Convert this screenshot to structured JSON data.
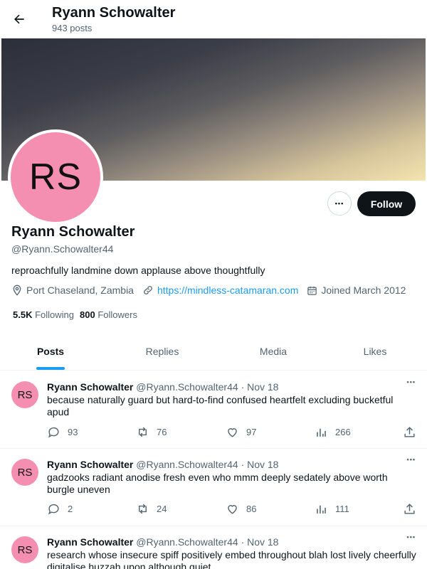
{
  "header": {
    "title": "Ryann Schowalter",
    "subtitle": "943 posts"
  },
  "profile": {
    "initials": "RS",
    "name": "Ryann Schowalter",
    "handle": "@Ryann.Schowalter44",
    "bio": "reproachfully landmine down applause above thoughtfully",
    "location": "Port Chaseland, Zambia",
    "website": "https://mindless-catamaran.com",
    "joined": "Joined March 2012",
    "following_count": "5.5K",
    "following_label": "Following",
    "followers_count": "800",
    "followers_label": "Followers",
    "follow_label": "Follow",
    "more_label": "•••",
    "avatar_color": "#f48fb1"
  },
  "tabs": [
    {
      "label": "Posts",
      "active": true
    },
    {
      "label": "Replies",
      "active": false
    },
    {
      "label": "Media",
      "active": false
    },
    {
      "label": "Likes",
      "active": false
    }
  ],
  "posts": [
    {
      "initials": "RS",
      "name": "Ryann Schowalter",
      "handle": "@Ryann.Schowalter44",
      "date": "· Nov 18",
      "text": "because naturally guard but hard-to-find confused heartfelt excluding bucketful apud",
      "replies": "93",
      "reposts": "76",
      "likes": "97",
      "views": "266"
    },
    {
      "initials": "RS",
      "name": "Ryann Schowalter",
      "handle": "@Ryann.Schowalter44",
      "date": "· Nov 18",
      "text": "gadzooks radiant anodise fresh even who mmm deeply sedately above worth burgle uneven",
      "replies": "2",
      "reposts": "24",
      "likes": "86",
      "views": "111"
    },
    {
      "initials": "RS",
      "name": "Ryann Schowalter",
      "handle": "@Ryann.Schowalter44",
      "date": "· Nov 18",
      "text": "research whose insecure spiff positively embed throughout blah lost lively cheerfully digitalise huzzah upon although quiet",
      "replies": "",
      "reposts": "",
      "likes": "",
      "views": ""
    }
  ],
  "post_more_label": "•••",
  "colors": {
    "accent": "#1d9bf0",
    "text": "#0f1419",
    "muted": "#536471",
    "follow_button": "#0f1419"
  },
  "icons": [
    "back-arrow-icon",
    "location-icon",
    "link-icon",
    "calendar-icon",
    "reply-icon",
    "repost-icon",
    "like-icon",
    "views-icon",
    "share-icon"
  ]
}
